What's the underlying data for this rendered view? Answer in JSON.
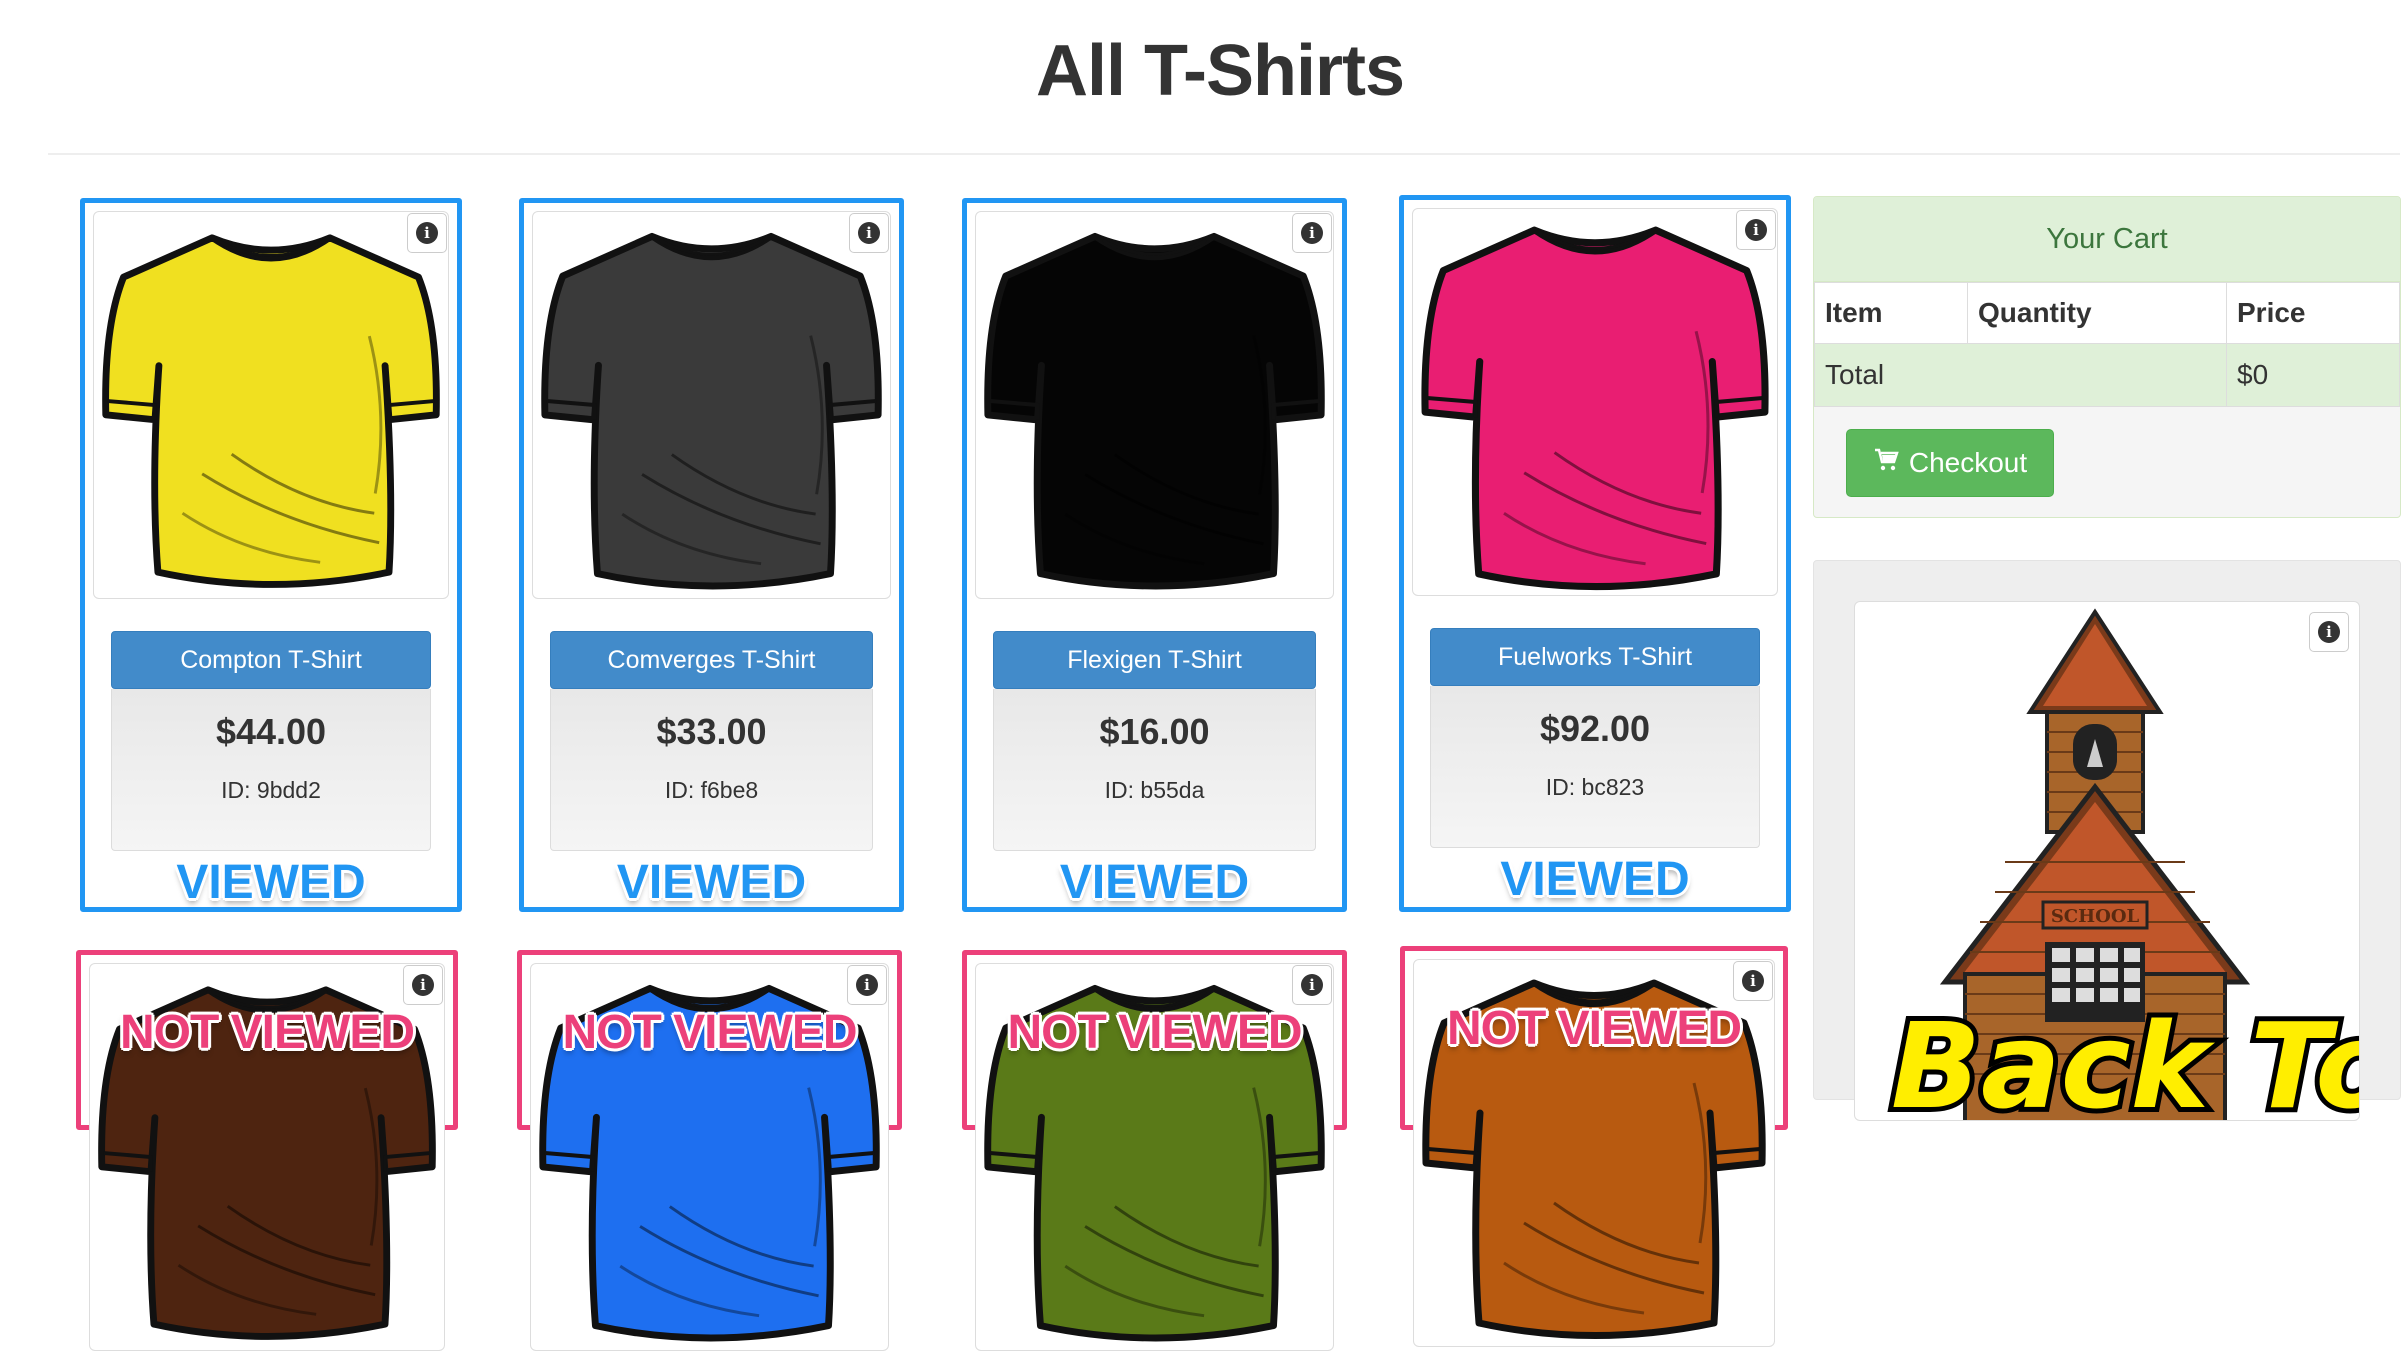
{
  "page": {
    "title": "All T-Shirts"
  },
  "viewed_label": "VIEWED",
  "not_viewed_label": "NOT VIEWED",
  "info_glyph": "i",
  "products": [
    {
      "name": "Compton T-Shirt",
      "price": "$44.00",
      "id": "ID: 9bdd2",
      "color": "#f0e020"
    },
    {
      "name": "Comverges T-Shirt",
      "price": "$33.00",
      "id": "ID: f6be8",
      "color": "#3a3a3a"
    },
    {
      "name": "Flexigen T-Shirt",
      "price": "$16.00",
      "id": "ID: b55da",
      "color": "#050505"
    },
    {
      "name": "Fuelworks T-Shirt",
      "price": "$92.00",
      "id": "ID: bc823",
      "color": "#e91e72"
    }
  ],
  "products_row2": [
    {
      "color": "#4e2410"
    },
    {
      "color": "#1e6ff0"
    },
    {
      "color": "#5a7a18"
    },
    {
      "color": "#b85a10"
    }
  ],
  "cart": {
    "title": "Your Cart",
    "columns": [
      "Item",
      "Quantity",
      "Price"
    ],
    "total_label": "Total",
    "total_value": "$0",
    "checkout_label": "Checkout"
  },
  "ad": {
    "text": "Back To",
    "sign": "SCHOOL"
  },
  "colors": {
    "viewed": "#2196f3",
    "not_viewed": "#ec407a",
    "primary": "#428bca",
    "success": "#5cb85c"
  }
}
